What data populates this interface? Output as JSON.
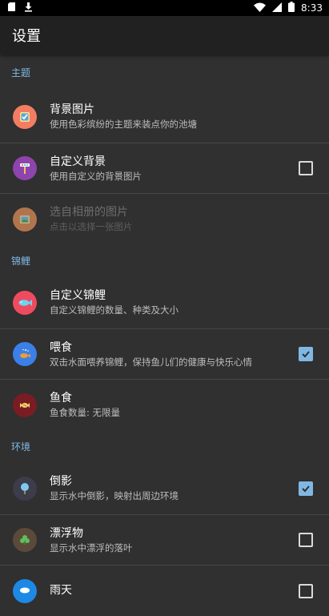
{
  "status_bar": {
    "time": "8:33"
  },
  "app_bar": {
    "title": "设置"
  },
  "sections": {
    "theme": {
      "header": "主题",
      "items": [
        {
          "title": "背景图片",
          "summary": "使用色彩缤纷的主题来装点你的池塘"
        },
        {
          "title": "自定义背景",
          "summary": "使用自定义的背景图片",
          "checked": false
        },
        {
          "title": "选自相册的图片",
          "summary": "点击以选择一张图片",
          "disabled": true
        }
      ]
    },
    "koi": {
      "header": "锦鲤",
      "items": [
        {
          "title": "自定义锦鲤",
          "summary": "自定义锦鲤的数量、种类及大小"
        },
        {
          "title": "喂食",
          "summary": "双击水面喂养锦鲤，保持鱼儿们的健康与快乐心情",
          "checked": true
        },
        {
          "title": "鱼食",
          "summary": "鱼食数量: 无限量"
        }
      ]
    },
    "environment": {
      "header": "环境",
      "items": [
        {
          "title": "倒影",
          "summary": "显示水中倒影，映射出周边环境",
          "checked": true
        },
        {
          "title": "漂浮物",
          "summary": "显示水中漂浮的落叶",
          "checked": false
        },
        {
          "title": "雨天",
          "summary": "",
          "checked": false
        }
      ]
    }
  },
  "colors": {
    "accent": "#80b8e4",
    "background": "#303030",
    "app_bar": "#212121"
  },
  "icons": {
    "background_image": "picture-frame-icon",
    "custom_background": "signpost-icon",
    "album_picture": "landscape-photo-icon",
    "custom_koi": "fish-icon",
    "feed": "feeding-fish-icon",
    "fish_food": "food-pellets-icon",
    "reflection": "tree-reflection-icon",
    "floating": "leaf-icon",
    "rain": "rain-cloud-icon"
  }
}
